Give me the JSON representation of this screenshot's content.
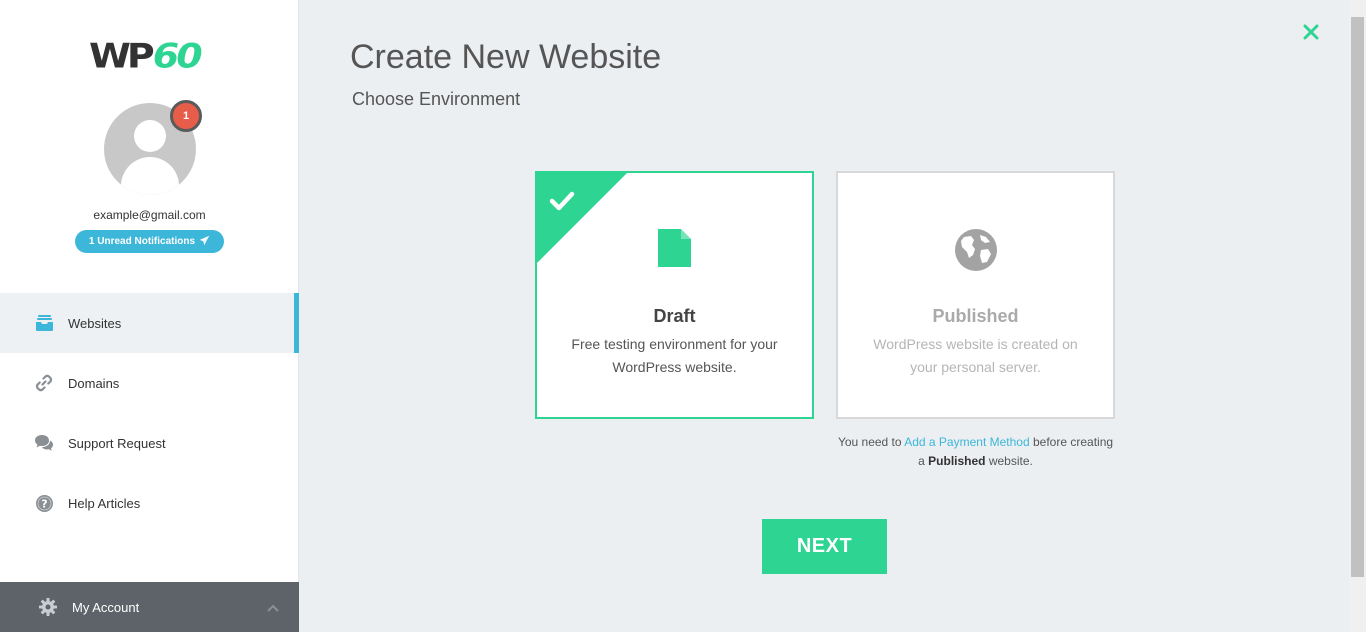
{
  "sidebar": {
    "logo": {
      "part1": "WP",
      "part2": "60"
    },
    "user": {
      "email": "example@gmail.com",
      "badge_count": "1",
      "notifications_label": "1 Unread Notifications"
    },
    "nav": [
      {
        "label": "Websites",
        "icon": "inbox-icon",
        "active": true
      },
      {
        "label": "Domains",
        "icon": "link-icon",
        "active": false
      },
      {
        "label": "Support Request",
        "icon": "chat-icon",
        "active": false
      },
      {
        "label": "Help Articles",
        "icon": "question-icon",
        "active": false
      }
    ],
    "account": {
      "label": "My Account",
      "icon": "gear-icon"
    }
  },
  "main": {
    "title": "Create New Website",
    "subtitle": "Choose Environment",
    "options": [
      {
        "title": "Draft",
        "description": "Free testing environment for your WordPress website.",
        "selected": true,
        "icon": "file-icon"
      },
      {
        "title": "Published",
        "description": "WordPress website is created on your personal server.",
        "selected": false,
        "icon": "globe-icon"
      }
    ],
    "payment_note": {
      "prefix": "You need to ",
      "link": "Add a Payment Method",
      "middle": " before creating a ",
      "bold": "Published",
      "suffix": " website."
    },
    "next_label": "NEXT"
  },
  "colors": {
    "accent_green": "#2ed592",
    "accent_blue": "#3cb6d9",
    "badge_red": "#e85c4a",
    "sidebar_footer": "#5d6369"
  }
}
